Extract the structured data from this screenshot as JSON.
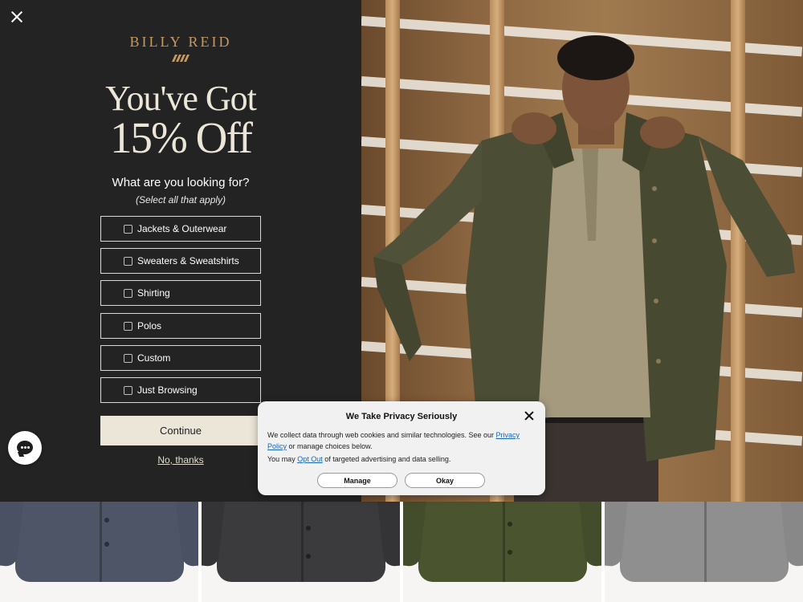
{
  "popup": {
    "close_icon": "close-icon",
    "brand": "BILLY REID",
    "brand_mark_icon": "diagonal-stripes-logo",
    "headline_line1": "You've Got",
    "headline_line2": "15% Off",
    "question": "What are you looking for?",
    "subquestion": "(Select all that apply)",
    "options": [
      {
        "label": "Jackets & Outerwear",
        "checked": false
      },
      {
        "label": "Sweaters & Sweatshirts",
        "checked": false
      },
      {
        "label": "Shirting",
        "checked": false
      },
      {
        "label": "Polos",
        "checked": false
      },
      {
        "label": "Custom",
        "checked": false
      },
      {
        "label": "Just Browsing",
        "checked": false
      }
    ],
    "continue_label": "Continue",
    "no_thanks_label": "No, thanks",
    "colors": {
      "panel": "#232323",
      "accent_gold": "#c49a63",
      "cream": "#ece6d8"
    }
  },
  "chat": {
    "icon": "chat-bubble-icon"
  },
  "privacy": {
    "title": "We Take Privacy Seriously",
    "text_part1": "We collect data through web cookies and similar technologies. See our ",
    "privacy_link": "Privacy Policy",
    "text_part2": " or manage choices below.",
    "optout_prefix": "You may ",
    "optout_link": "Opt Out",
    "optout_suffix": " of targeted advertising and data selling.",
    "manage_label": "Manage",
    "okay_label": "Okay",
    "link_color": "#1a64b8"
  },
  "products": [
    {
      "name": "gray-knit-shirt-jacket",
      "color": "#4e5566"
    },
    {
      "name": "charcoal-wool-jacket",
      "color": "#3b3a3d"
    },
    {
      "name": "olive-field-jacket",
      "color": "#4a5530"
    },
    {
      "name": "heather-gray-zip-sweater",
      "color": "#8f8f8f"
    }
  ]
}
